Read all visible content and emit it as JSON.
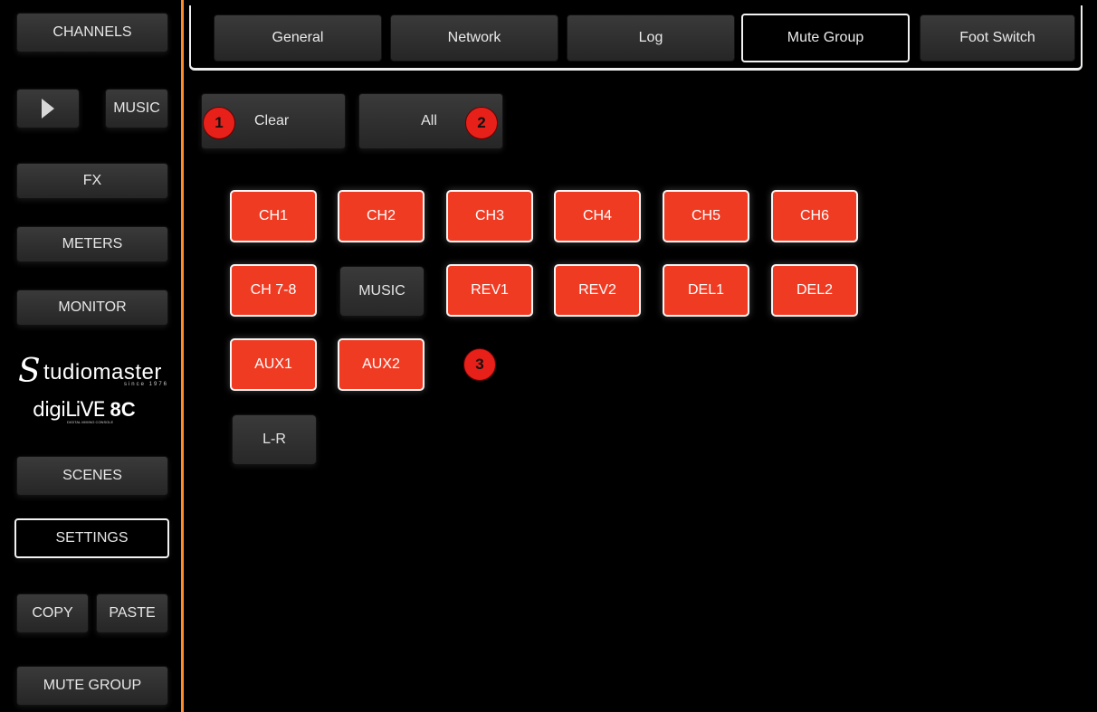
{
  "sidebar": {
    "channels": "CHANNELS",
    "music": "MUSIC",
    "fx": "FX",
    "meters": "METERS",
    "monitor": "MONITOR",
    "logo_brand_initial": "S",
    "logo_brand_rest": "tudiomaster",
    "logo_since": "since 1976",
    "logo_product_a": "digiLiVE",
    "logo_product_b": "8C",
    "logo_product_tagline": "DIGITAL MIXING CONSOLE",
    "scenes": "SCENES",
    "settings": "SETTINGS",
    "copy": "COPY",
    "paste": "PASTE",
    "mute_group": "MUTE GROUP"
  },
  "tabs": [
    "General",
    "Network",
    "Log",
    "Mute Group",
    "Foot Switch"
  ],
  "selected_tab": "Mute Group",
  "actions": {
    "clear": "Clear",
    "all": "All"
  },
  "callouts": [
    "1",
    "2",
    "3"
  ],
  "channels": [
    {
      "label": "CH1",
      "muted": true
    },
    {
      "label": "CH2",
      "muted": true
    },
    {
      "label": "CH3",
      "muted": true
    },
    {
      "label": "CH4",
      "muted": true
    },
    {
      "label": "CH5",
      "muted": true
    },
    {
      "label": "CH6",
      "muted": true
    },
    {
      "label": "CH 7-8",
      "muted": true
    },
    {
      "label": "MUSIC",
      "muted": false
    },
    {
      "label": "REV1",
      "muted": true
    },
    {
      "label": "REV2",
      "muted": true
    },
    {
      "label": "DEL1",
      "muted": true
    },
    {
      "label": "DEL2",
      "muted": true
    },
    {
      "label": "AUX1",
      "muted": true
    },
    {
      "label": "AUX2",
      "muted": true
    },
    {
      "label": "L-R",
      "muted": false
    }
  ],
  "colors": {
    "accent_divider": "#ff8a2b",
    "muted_red": "#f03b23",
    "callout_red": "#e8201a"
  }
}
